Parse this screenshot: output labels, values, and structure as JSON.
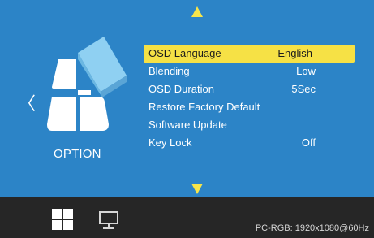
{
  "nav": {
    "up_icon": "triangle-up-icon",
    "down_icon": "triangle-down-icon",
    "left_arrow": "〈"
  },
  "category": {
    "label": "OPTION",
    "icon": "option-blocks-icon"
  },
  "menu": {
    "items": [
      {
        "label": "OSD Language",
        "value": "English",
        "selected": true
      },
      {
        "label": "Blending",
        "value": "Low"
      },
      {
        "label": "OSD Duration",
        "value": "5Sec"
      },
      {
        "label": "Restore Factory  Default",
        "value": ""
      },
      {
        "label": "Software Update",
        "value": ""
      },
      {
        "label": "Key Lock",
        "value": "Off"
      }
    ]
  },
  "footer": {
    "tabs": [
      {
        "icon": "grid-icon"
      },
      {
        "icon": "monitor-icon"
      }
    ],
    "status": "PC-RGB: 1920x1080@60Hz"
  },
  "colors": {
    "background": "#2c84c7",
    "highlight": "#f6e145",
    "footer": "#262626"
  }
}
